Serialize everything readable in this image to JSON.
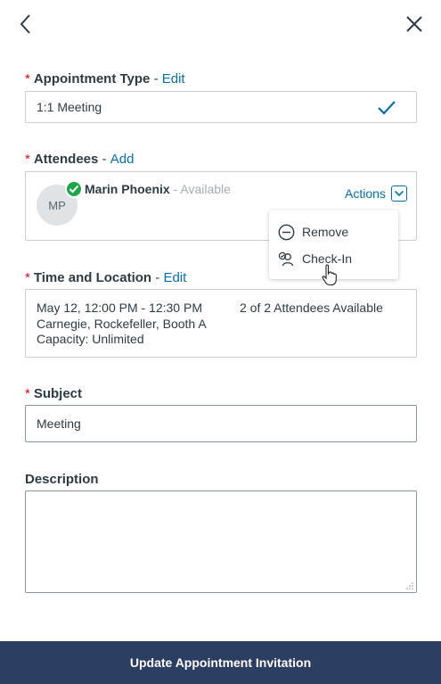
{
  "header": {
    "back_icon": "chevron-left-icon",
    "close_icon": "close-icon"
  },
  "appointment_type": {
    "required_mark": "*",
    "label": "Appointment Type",
    "separator": "-",
    "action": "Edit",
    "value": "1:1 Meeting",
    "check_icon": "checkmark-icon"
  },
  "attendees": {
    "required_mark": "*",
    "label": "Attendees",
    "separator": "-",
    "action": "Add",
    "items": [
      {
        "initials": "MP",
        "name": "Marin Phoenix",
        "status": " - Available",
        "badge_icon": "check-circle-icon"
      }
    ],
    "actions_label": "Actions",
    "menu": [
      {
        "label": "Remove",
        "icon": "minus-circle-icon"
      },
      {
        "label": "Check-In",
        "icon": "check-in-icon"
      }
    ]
  },
  "time_location": {
    "required_mark": "*",
    "label": "Time and Location",
    "separator": "-",
    "action": "Edit",
    "time": "May 12, 12:00 PM - 12:30 PM",
    "location": "Carnegie, Rockefeller, Booth A",
    "capacity": "Capacity: Unlimited",
    "availability": "2 of 2 Attendees Available"
  },
  "subject": {
    "required_mark": "*",
    "label": "Subject",
    "value": "Meeting"
  },
  "description": {
    "label": "Description",
    "value": ""
  },
  "footer": {
    "button_label": "Update Appointment Invitation"
  },
  "colors": {
    "link": "#0770a3",
    "required": "#e0061f",
    "available_badge": "#1fa64a",
    "footer_bg": "#2c3e61"
  }
}
